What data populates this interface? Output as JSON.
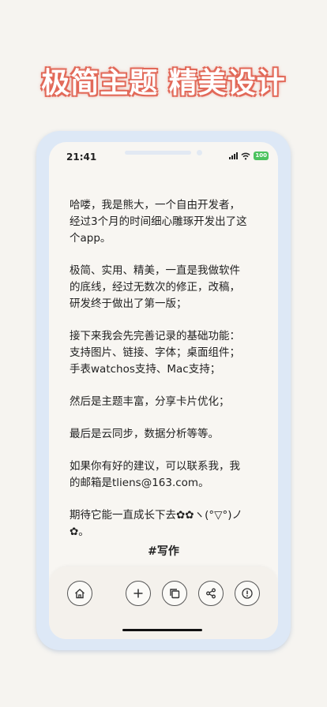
{
  "headline": "极简主题 精美设计",
  "status_bar": {
    "time": "21:41",
    "battery": "100"
  },
  "note": {
    "paragraphs": [
      "哈喽，我是熊大，一个自由开发者，\n经过3个月的时间细心雕琢开发出了这\n个app。",
      "极简、实用、精美，一直是我做软件\n的底线，经过无数次的修正，改稿，\n研发终于做出了第一版；",
      "接下来我会先完善记录的基础功能：\n支持图片、链接、字体；桌面组件；\n手表watchos支持、Mac支持；",
      "然后是主题丰富，分享卡片优化；",
      "最后是云同步，数据分析等等。",
      "如果你有好的建议，可以联系我，我\n的邮箱是tliens@163.com。",
      "期待它能一直成长下去✿✿ヽ(°▽°)ノ\n✿。"
    ],
    "tag": "#写作"
  },
  "toolbar": {
    "buttons": [
      "home-icon",
      "plus-icon",
      "copy-icon",
      "share-icon",
      "alert-icon"
    ]
  }
}
